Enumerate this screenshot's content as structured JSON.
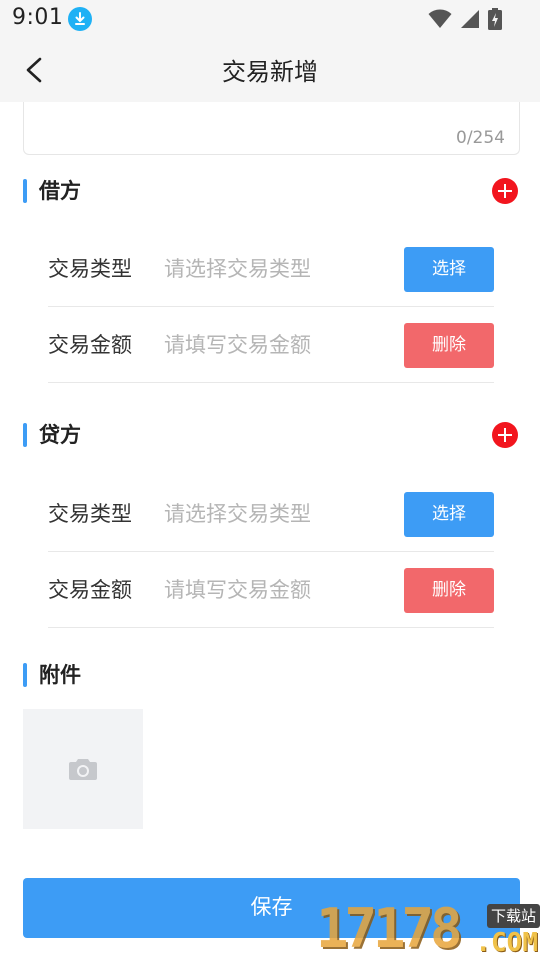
{
  "status_bar": {
    "time": "9:01"
  },
  "nav": {
    "title": "交易新增"
  },
  "remark": {
    "char_count": "0/254"
  },
  "debit": {
    "title": "借方",
    "type_label": "交易类型",
    "type_placeholder": "请选择交易类型",
    "select_label": "选择",
    "amount_label": "交易金额",
    "amount_placeholder": "请填写交易金额",
    "delete_label": "删除"
  },
  "credit": {
    "title": "贷方",
    "type_label": "交易类型",
    "type_placeholder": "请选择交易类型",
    "select_label": "选择",
    "amount_label": "交易金额",
    "amount_placeholder": "请填写交易金额",
    "delete_label": "删除"
  },
  "attachment": {
    "title": "附件"
  },
  "footer": {
    "save_label": "保存"
  },
  "watermark": {
    "digits": "17178",
    "suffix": ".COM",
    "tag": "下载站"
  },
  "colors": {
    "accent": "#3d9cf5",
    "danger": "#f2686b",
    "add": "#f2151e"
  },
  "icons": [
    "download-icon",
    "wifi-icon",
    "signal-icon",
    "battery-icon",
    "back-arrow-icon",
    "plus-icon",
    "camera-icon"
  ]
}
